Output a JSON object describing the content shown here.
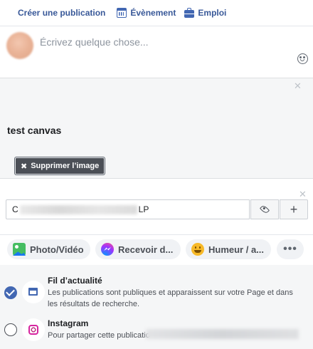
{
  "tabs": {
    "create_post": "Créer une publication",
    "event": "Évènement",
    "job": "Emploi"
  },
  "composer": {
    "placeholder": "Écrivez quelque chose..."
  },
  "preview": {
    "title": "test canvas",
    "remove_image": "Supprimer l’image"
  },
  "cta": {
    "value_start": "C",
    "value_end": "LP",
    "plus": "+"
  },
  "actions": {
    "photo_video": "Photo/Vidéo",
    "messages": "Recevoir d...",
    "feeling": "Humeur / a...",
    "more": "•••"
  },
  "audience": {
    "news_feed": {
      "title": "Fil d’actualité",
      "description": "Les publications sont publiques et apparaissent sur votre Page et dans les résultats de recherche.",
      "selected": true
    },
    "instagram": {
      "title": "Instagram",
      "description": "Pour partager cette publicatio",
      "selected": false
    }
  },
  "colors": {
    "link_blue": "#385898",
    "brand_blue": "#4267b2",
    "panel_gray": "#f5f6f7"
  }
}
